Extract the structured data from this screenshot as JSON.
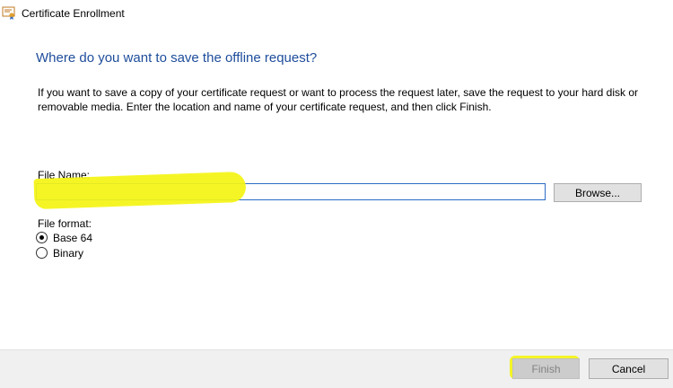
{
  "window": {
    "title": "Certificate Enrollment",
    "icon": "certificate-icon"
  },
  "page": {
    "heading": "Where do you want to save the offline request?",
    "description": "If you want to save a copy of your certificate request or want to process the request later, save the request to your hard disk or removable media. Enter the location and name of your certificate request, and then click Finish."
  },
  "file": {
    "label": "File Name:",
    "value": "",
    "browse_label": "Browse..."
  },
  "format": {
    "label": "File format:",
    "options": [
      {
        "label": "Base 64",
        "selected": true
      },
      {
        "label": "Binary",
        "selected": false
      }
    ]
  },
  "footer": {
    "finish_label": "Finish",
    "cancel_label": "Cancel"
  },
  "colors": {
    "heading": "#1e4d9b",
    "highlight": "#f4f414",
    "input_border": "#2b6cc4"
  }
}
